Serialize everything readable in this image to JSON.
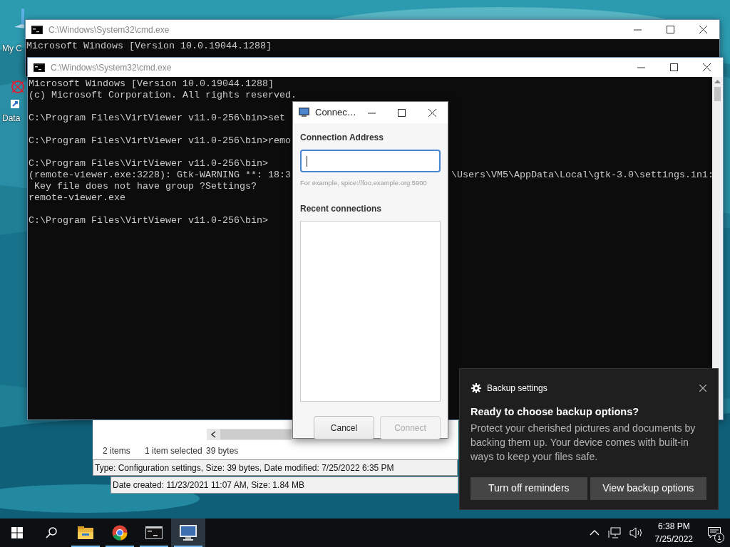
{
  "desktop_icons": [
    {
      "label": "My C"
    },
    {
      "label": "Data"
    }
  ],
  "back_console": {
    "title": "C:\\Windows\\System32\\cmd.exe",
    "lines": [
      "Microsoft Windows [Version 10.0.19044.1288]"
    ]
  },
  "front_console": {
    "title": "C:\\Windows\\System32\\cmd.exe",
    "blocks": [
      [
        "Microsoft Windows [Version 10.0.19044.1288]",
        "(c) Microsoft Corporation. All rights reserved."
      ],
      [
        "C:\\Program Files\\VirtViewer v11.0-256\\bin>set"
      ],
      [
        "C:\\Program Files\\VirtViewer v11.0-256\\bin>remo"
      ],
      [
        "C:\\Program Files\\VirtViewer v11.0-256\\bin>",
        "(remote-viewer.exe:3228): Gtk-WARNING **: 18:3",
        " Key file does not have group ?Settings?",
        "remote-viewer.exe"
      ],
      [
        "C:\\Program Files\\VirtViewer v11.0-256\\bin>"
      ]
    ],
    "warning_tail": "\\Users\\VM5\\AppData\\Local\\gtk-3.0\\settings.ini:"
  },
  "explorer": {
    "status": [
      "2 items",
      "1 item selected",
      "39 bytes"
    ],
    "tooltips": [
      "Type: Configuration settings, Size: 39 bytes, Date modified: 7/25/2022 6:35 PM",
      "Date created: 11/23/2021 11:07 AM, Size: 1.84 MB"
    ]
  },
  "dialog": {
    "title": "Connec…",
    "address_label": "Connection Address",
    "address_focused": true,
    "hint": "For example, spice://foo.example.org:5900",
    "recent_label": "Recent connections",
    "buttons": [
      {
        "label": "Cancel",
        "disabled": false
      },
      {
        "label": "Connect",
        "disabled": true
      }
    ]
  },
  "toast": {
    "app": "Backup settings",
    "title": "Ready to choose backup options?",
    "body": "Protect your cherished pictures and documents by backing them up. Your device comes with built-in ways to keep your files safe.",
    "buttons": [
      "Turn off reminders",
      "View backup options"
    ]
  },
  "taskbar": {
    "apps": [
      {
        "kind": "folder",
        "selected": false
      },
      {
        "kind": "browser",
        "selected": false
      },
      {
        "kind": "console",
        "selected": false
      },
      {
        "kind": "viewer",
        "selected": true
      }
    ],
    "time": "6:38 PM",
    "date": "7/25/2022",
    "notification_count": "1"
  }
}
